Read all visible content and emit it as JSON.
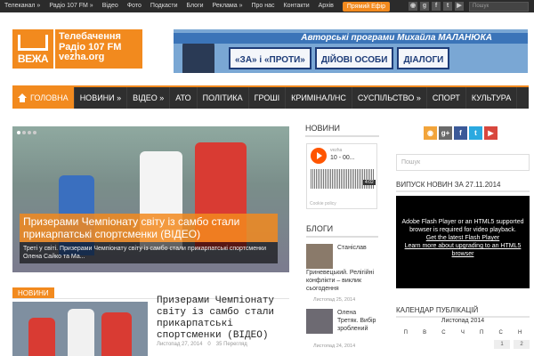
{
  "topbar": {
    "menu": [
      "Телеканал »",
      "Радіо 107 FM »",
      "Відео",
      "Фото",
      "Подкасти",
      "Блоги",
      "Реклама »",
      "Про нас",
      "Контакти",
      "Архів"
    ],
    "live_button": "Прямий Ефір",
    "search_placeholder": "Пошук"
  },
  "logo": {
    "word": "ВЕЖА",
    "line1": "Телебачення",
    "line2": "Радіо 107 FM",
    "line3": "vezha.org"
  },
  "banner": {
    "top": "Авторські програми Михайла МАЛАНЮКА",
    "cells": [
      "«ЗА» і «ПРОТИ»",
      "ДІЙОВІ ОСОБИ",
      "ДІАЛОГИ"
    ]
  },
  "mainnav": {
    "home": "ГОЛОВНА",
    "items": [
      "НОВИНИ »",
      "ВІДЕО »",
      "АТО",
      "ПОЛІТИКА",
      "ГРОШІ",
      "КРИМІНАЛ/НС",
      "СУСПІЛЬСТВО »",
      "СПОРТ",
      "КУЛЬТУРА"
    ]
  },
  "slider": {
    "title": "Призерами Чемпіонату світу із самбо стали прикарпатські спортсменки (ВІДЕО)",
    "caption": "Треті у світі. Призерами Чемпіонату світу із самбо стали прикарпатські спортсменки Олена Сайко та Ма..."
  },
  "news": {
    "tab": "НОВИНИ",
    "title": "Призерами Чемпіонату світу із самбо стали прикарпатські спортсменки (ВІДЕО)",
    "date": "Листопад 27, 2014",
    "comments": "0",
    "views": "35 Перегляд"
  },
  "middle": {
    "news_title": "НОВИНИ",
    "player": {
      "user": "vezha",
      "track": "10 - 00...",
      "time": "4:02",
      "footer": "Cookie policy"
    },
    "blogs_title": "БЛОГИ",
    "blogs": [
      {
        "text": "Станіслав",
        "text2": "Гриневецький. Релігійні конфлікти – виклик сьогодення",
        "date": "Листопад 25, 2014"
      },
      {
        "text": "Олена Третяк. Вибір зроблений",
        "date": "Листопад 24, 2014"
      }
    ]
  },
  "right": {
    "socials": [
      "rss",
      "g+",
      "f",
      "t",
      "yt"
    ],
    "search_placeholder": "Пошук",
    "video_title": "ВИПУСК НОВИН ЗА 27.11.2014",
    "video_msg1": "Adobe Flash Player or an HTML5 supported browser is required for video playback.",
    "video_link1": "Get the latest Flash Player",
    "video_link2": "Learn more about upgrading to an HTML5 browser",
    "calendar_title": "КАЛЕНДАР ПУБЛІКАЦІЙ",
    "calendar_month": "Листопад 2014",
    "calendar_days": [
      "П",
      "В",
      "С",
      "Ч",
      "П",
      "С",
      "Н"
    ],
    "calendar_first": [
      "1",
      "2"
    ]
  },
  "colors": {
    "accent": "#f28a1e",
    "dark": "#2f2f2f"
  }
}
